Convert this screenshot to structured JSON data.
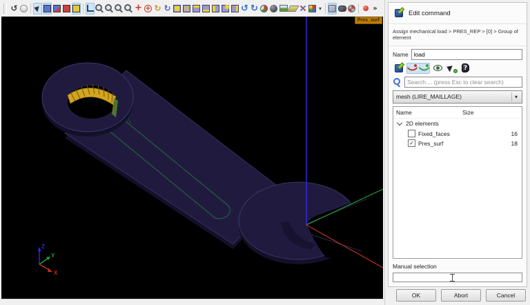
{
  "toolbar": {
    "items": [
      {
        "name": "refresh-view-icon",
        "kind": "k-hist"
      },
      {
        "name": "wait-clock-icon",
        "kind": "k-clock"
      },
      {
        "kind": "sep"
      },
      {
        "name": "interaction-style-icon",
        "kind": "k-cursorzoom",
        "sel": true
      },
      {
        "name": "selection-node-icon",
        "kind": "k-sq k-sq-blue",
        "sel": true
      },
      {
        "name": "selection-mixed-icon",
        "kind": "k-sq k-sq-mix"
      },
      {
        "name": "selection-edge-icon",
        "kind": "k-sq k-sq-red"
      },
      {
        "name": "selection-face-icon",
        "kind": "k-sq k-sq-yel",
        "sel": true
      },
      {
        "kind": "sep"
      },
      {
        "name": "show-trihedron-icon",
        "kind": "k-axes",
        "sel": true
      },
      {
        "name": "fit-all-icon",
        "kind": "k-zoom"
      },
      {
        "name": "zoom-window-icon",
        "kind": "k-zoom"
      },
      {
        "name": "zoom-selection-icon",
        "kind": "k-zoom"
      },
      {
        "name": "zoom-icon",
        "kind": "k-zoom"
      },
      {
        "name": "pan-icon",
        "kind": "k-pan"
      },
      {
        "name": "global-pan-icon",
        "kind": "k-pang"
      },
      {
        "name": "rotate-view-icon",
        "kind": "k-rot"
      },
      {
        "name": "rotation-point-icon",
        "kind": "k-rotb"
      },
      {
        "name": "view-front-icon",
        "kind": "k-cube k-vfront"
      },
      {
        "name": "view-back-icon",
        "kind": "k-cube k-vback"
      },
      {
        "name": "view-top-icon",
        "kind": "k-cube k-vtop"
      },
      {
        "name": "view-bottom-icon",
        "kind": "k-cube k-vbot"
      },
      {
        "name": "view-left-icon",
        "kind": "k-cube k-vleft"
      },
      {
        "name": "view-right-icon",
        "kind": "k-cube k-viso"
      },
      {
        "name": "view-iso-icon",
        "kind": "k-cube k-vright"
      },
      {
        "name": "rotate-left-icon",
        "kind": "k-undo"
      },
      {
        "name": "rotate-right-icon",
        "kind": "k-redo"
      },
      {
        "name": "update-scene-icon",
        "kind": "k-gauge"
      },
      {
        "name": "shaded-sphere-icon",
        "kind": "k-sphere"
      },
      {
        "name": "background-image-icon",
        "kind": "k-img"
      },
      {
        "name": "clipping-plane-icon",
        "kind": "k-plane"
      },
      {
        "name": "sync-views-icon",
        "kind": "k-clip"
      },
      {
        "name": "view-mode-icon",
        "kind": "k-grid4"
      },
      {
        "name": "view-mode-dropdown-icon",
        "kind": "k-dd"
      },
      {
        "kind": "sep"
      },
      {
        "name": "shading-mode-icon",
        "kind": "k-shadecube",
        "sel": true
      },
      {
        "name": "shape-display-icon",
        "kind": "k-shadedark"
      },
      {
        "name": "texture-icon",
        "kind": "k-checker"
      },
      {
        "kind": "sep"
      },
      {
        "name": "record-icon",
        "kind": "k-dotred"
      },
      {
        "name": "toolbar-overflow-icon",
        "kind": "k-chev"
      }
    ]
  },
  "viewport": {
    "selection_label": "Pres_surf",
    "triad": {
      "x_label": "X",
      "y_label": "Y",
      "z_label": "Z"
    },
    "colors": {
      "background": "#000000",
      "body_top": "#201b3e",
      "body_side": "#14102a",
      "edge": "#3a3768",
      "highlight_mesh": "#d4a41e",
      "highlight_hatch": "#6e5a0e",
      "highlight_edge_green": "#57802a",
      "slot_edge_green": "#266b40",
      "axis_x_red": "#c03020",
      "axis_y_green": "#21a13b",
      "axis_z_blue": "#2b2bd8",
      "label_bg": "#bf7d05",
      "label_text": "#3a2600"
    }
  },
  "panel": {
    "title": "Edit command",
    "breadcrumb": "Assign mechanical load > PRES_REP > [0] > Group of element",
    "name_label": "Name",
    "name_value": "load",
    "tools": [
      {
        "name": "edit-mode-icon",
        "kind": "k-editcmd"
      },
      {
        "name": "curve-red-icon",
        "kind": "k-curve k-curve-red",
        "grp": true
      },
      {
        "name": "curve-green-icon",
        "kind": "k-curve k-curve-green",
        "grp": true
      },
      {
        "name": "preview-eye-icon",
        "kind": "k-eye"
      },
      {
        "name": "pick-selection-icon",
        "kind": "k-pick"
      },
      {
        "name": "documentation-icon",
        "kind": "k-doc"
      }
    ],
    "search_placeholder": "Search.... (press Esc to clear search)",
    "mesh_selector": "mesh (LIRE_MAILLAGE)",
    "tree": {
      "name_col": "Name",
      "size_col": "Size",
      "group_label": "2D elements",
      "items": [
        {
          "label": "Fixed_faces",
          "size": "16",
          "checked": false
        },
        {
          "label": "Pres_surf",
          "size": "18",
          "checked": true
        }
      ]
    },
    "manual_selection_label": "Manual selection",
    "manual_selection_value": "",
    "buttons": {
      "ok": "OK",
      "abort": "Abort",
      "cancel": "Cancel"
    }
  }
}
